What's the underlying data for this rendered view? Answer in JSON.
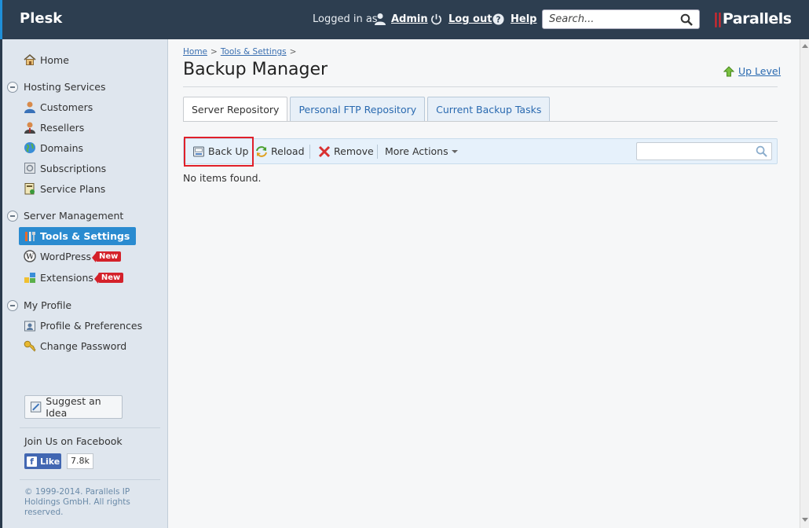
{
  "header": {
    "brand": "Plesk",
    "logged_in_as": "Logged in as",
    "user": "Admin",
    "logout": "Log out",
    "help": "Help",
    "search_placeholder": "Search...",
    "vendor": "Parallels",
    "vendor_bars": "||"
  },
  "sidebar": {
    "home": "Home",
    "groups": [
      {
        "label": "Hosting Services",
        "items": [
          "Customers",
          "Resellers",
          "Domains",
          "Subscriptions",
          "Service Plans"
        ]
      },
      {
        "label": "Server Management",
        "items": [
          "Tools & Settings",
          "WordPress",
          "Extensions"
        ]
      },
      {
        "label": "My Profile",
        "items": [
          "Profile & Preferences",
          "Change Password"
        ]
      }
    ],
    "new_badge": "New",
    "suggest_idea": "Suggest an Idea",
    "facebook_title": "Join Us on Facebook",
    "like_label": "Like",
    "like_count": "7.8k",
    "copyright": "© 1999-2014. Parallels IP Holdings GmbH. All rights reserved."
  },
  "main": {
    "breadcrumb": [
      "Home",
      "Tools & Settings"
    ],
    "breadcrumb_sep": ">",
    "title": "Backup Manager",
    "up_level": "Up Level",
    "tabs": [
      "Server Repository",
      "Personal FTP Repository",
      "Current Backup Tasks"
    ],
    "toolbar": {
      "back_up": "Back Up",
      "reload": "Reload",
      "remove": "Remove",
      "more_actions": "More Actions"
    },
    "empty_message": "No items found."
  },
  "colors": {
    "header_bg": "#2d3e50",
    "accent": "#2a8bd0",
    "badge": "#d4212a",
    "highlight": "#e0202a"
  }
}
